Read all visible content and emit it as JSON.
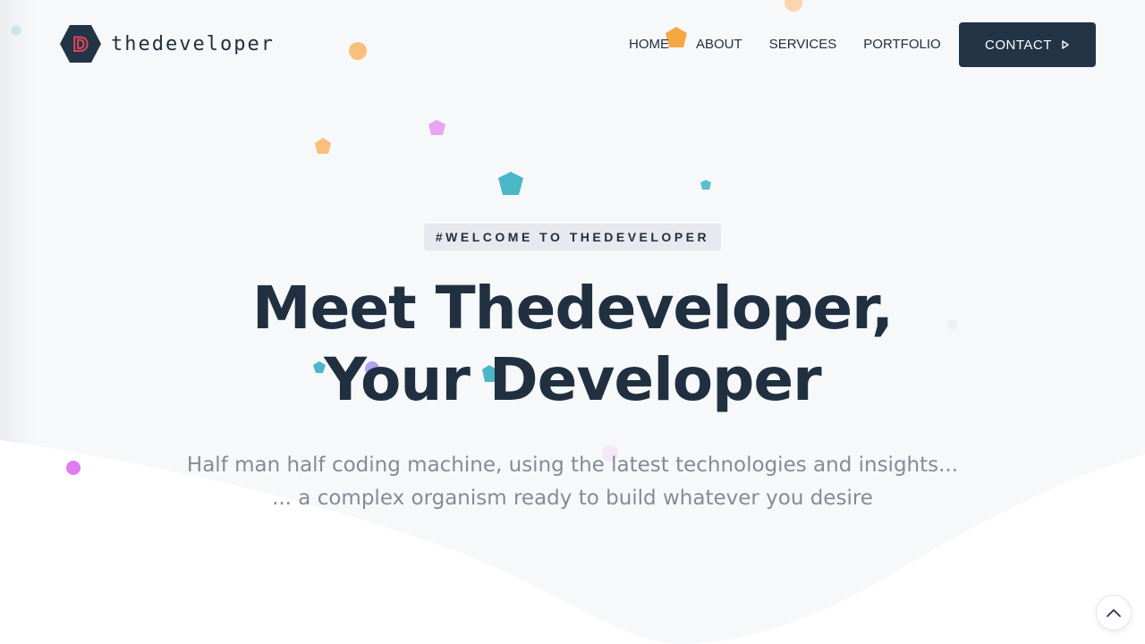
{
  "brand": {
    "name": "thedeveloper",
    "mark_letter": "D",
    "mark_color": "#233446",
    "mark_accent": "#e0455a"
  },
  "nav": {
    "items": [
      "HOME",
      "ABOUT",
      "SERVICES",
      "PORTFOLIO"
    ],
    "contact_label": "CONTACT",
    "contact_icon": "caret-right-icon"
  },
  "hero": {
    "tag": "#WELCOME TO THEDEVELOPER",
    "title_line1": "Meet Thedeveloper,",
    "title_line2": "Your Developer",
    "subtitle_line1": "Half man half coding machine, using the latest technologies and insights...",
    "subtitle_line2": "... a complex organism ready to build whatever you desire"
  },
  "scroll_top_icon": "chevron-up-icon",
  "colors": {
    "background": "#f7f8fa",
    "text": "#203040",
    "muted": "#848b98",
    "button": "#233446",
    "orange": "#f5a742",
    "teal": "#4bb6c8",
    "purple": "#b2a3ef",
    "pink": "#e07bf0"
  }
}
